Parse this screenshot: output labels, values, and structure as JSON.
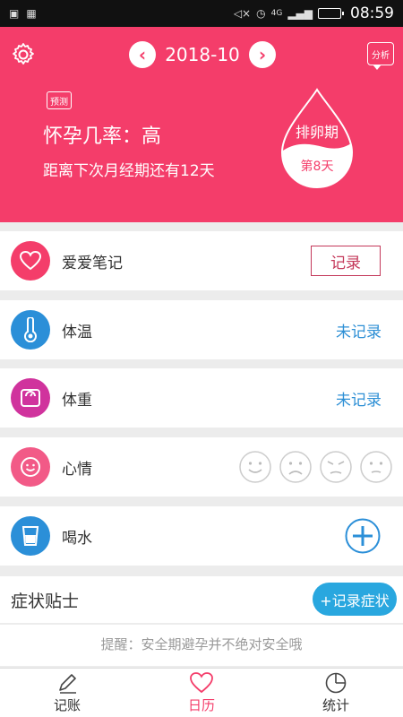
{
  "status_bar": {
    "time": "08:59",
    "network": "4G",
    "icons": [
      "image-icon",
      "qr-icon",
      "mute-icon",
      "alarm-icon",
      "signal-icon",
      "battery-icon"
    ]
  },
  "header": {
    "month": "2018-10",
    "analysis_label": "分析",
    "predict_tag": "预测",
    "pregnancy_rate": "怀孕几率：高",
    "period_countdown": "距离下次月经期还有12天",
    "phase_label": "排卵期",
    "phase_day": "第8天"
  },
  "records": {
    "love_note": {
      "label": "爱爱笔记",
      "button": "记录"
    },
    "temperature": {
      "label": "体温",
      "status": "未记录"
    },
    "weight": {
      "label": "体重",
      "status": "未记录"
    },
    "mood": {
      "label": "心情"
    },
    "water": {
      "label": "喝水"
    }
  },
  "symptoms": {
    "title": "症状贴士",
    "button": "+记录症状",
    "tip": "提醒：安全期避孕并不绝对安全哦"
  },
  "bottom_nav": {
    "tabs": [
      {
        "label": "记账",
        "icon": "pencil-icon"
      },
      {
        "label": "日历",
        "icon": "heart-icon"
      },
      {
        "label": "统计",
        "icon": "pie-chart-icon"
      }
    ],
    "active": "日历"
  },
  "colors": {
    "header": "#f43d6a",
    "love_icon": "#f43d6a",
    "temperature_icon": "#2b8fd8",
    "weight_icon": "#d0339d",
    "mood_icon": "#f25a87",
    "water_icon": "#2b8fd8",
    "link_blue": "#2d8fd5",
    "symptom_button": "#29a7df"
  }
}
